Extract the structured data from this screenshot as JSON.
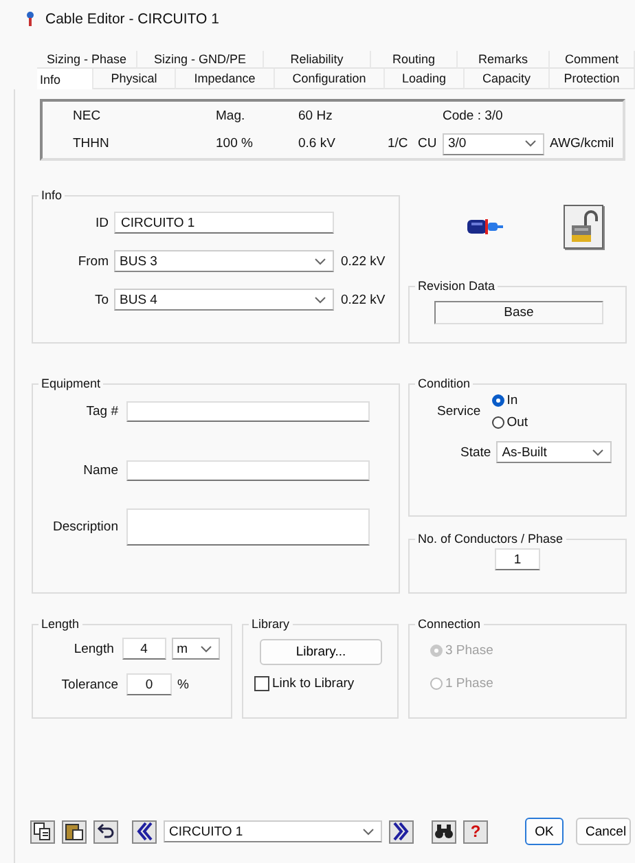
{
  "window": {
    "title": "Cable Editor - CIRCUITO 1"
  },
  "tabs_row_1": [
    {
      "label": "Sizing - Phase",
      "selected": false
    },
    {
      "label": "Sizing - GND/PE",
      "selected": false
    },
    {
      "label": "Reliability",
      "selected": false
    },
    {
      "label": "Routing",
      "selected": false
    },
    {
      "label": "Remarks",
      "selected": false
    },
    {
      "label": "Comment",
      "selected": false
    }
  ],
  "tabs_row_2": [
    {
      "label": "Info",
      "selected": true
    },
    {
      "label": "Physical",
      "selected": false
    },
    {
      "label": "Impedance",
      "selected": false
    },
    {
      "label": "Configuration",
      "selected": false
    },
    {
      "label": "Loading",
      "selected": false
    },
    {
      "label": "Capacity",
      "selected": false
    },
    {
      "label": "Protection",
      "selected": false
    }
  ],
  "summary": {
    "standard": "NEC",
    "insulation": "THHN",
    "mag": "Mag.",
    "percent": "100 %",
    "frequency": "60 Hz",
    "voltage": "0.6 kV",
    "conductors": "1/C",
    "material": "CU",
    "code": "Code : 3/0",
    "size": "3/0",
    "unit": "AWG/kcmil"
  },
  "info": {
    "title": "Info",
    "id_label": "ID",
    "id": "CIRCUITO 1",
    "from_label": "From",
    "from": "BUS 3",
    "from_kv": "0.22 kV",
    "to_label": "To",
    "to": "BUS 4",
    "to_kv": "0.22 kV"
  },
  "revision": {
    "title": "Revision Data",
    "value": "Base"
  },
  "equipment": {
    "title": "Equipment",
    "fields": [
      {
        "label": "Tag #",
        "kind": "line"
      },
      {
        "label": "Name",
        "kind": "line"
      },
      {
        "label": "Description",
        "kind": "area"
      }
    ]
  },
  "condition": {
    "title": "Condition",
    "service_label": "Service",
    "service_options": [
      {
        "label": "In",
        "selected": true
      },
      {
        "label": "Out",
        "selected": false
      }
    ],
    "state_label": "State",
    "state": "As-Built"
  },
  "conductors": {
    "title": "No. of Conductors / Phase",
    "value": "1"
  },
  "length": {
    "title": "Length",
    "length_label": "Length",
    "length": "4",
    "unit": "m",
    "tolerance_label": "Tolerance",
    "tolerance": "0",
    "tolerance_unit": "%"
  },
  "library": {
    "title": "Library",
    "button": "Library...",
    "link_label": "Link to Library",
    "link_checked": false
  },
  "connection": {
    "title": "Connection",
    "options": [
      {
        "label": "3 Phase",
        "selected": true,
        "disabled": true
      },
      {
        "label": "1 Phase",
        "selected": false,
        "disabled": true
      }
    ]
  },
  "footer": {
    "record": "CIRCUITO 1",
    "help": "?",
    "buttons": [
      "OK",
      "Cancel"
    ]
  }
}
